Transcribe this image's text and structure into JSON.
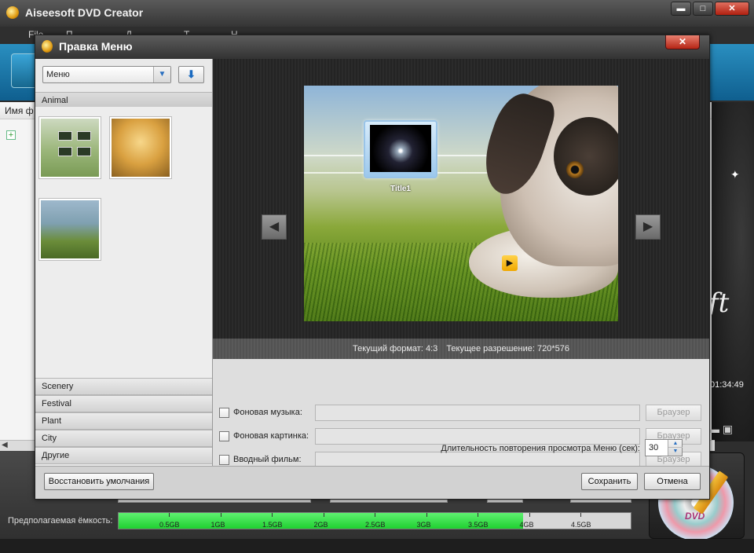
{
  "main_window": {
    "title": "Aiseesoft DVD Creator",
    "menu": [
      "File",
      "П",
      "Д",
      "T",
      "H"
    ],
    "window_buttons": {
      "minimize": "▬",
      "maximize": "□",
      "close": "✕"
    },
    "list_header": "Имя ф",
    "right_time": "01:34:49",
    "right_brand_fragment": "ft",
    "capacity_label": "Предполагаемая ёмкость:",
    "capacity_ticks": [
      "0.5GB",
      "1GB",
      "1.5GB",
      "2GB",
      "2.5GB",
      "3GB",
      "3.5GB",
      "4GB",
      "4.5GB"
    ],
    "capacity_fill_percent": 79,
    "disc_text": "DVD",
    "expand_glyph": "+"
  },
  "dialog": {
    "title": "Правка Меню",
    "close_glyph": "✕",
    "template_select": {
      "value": "Меню"
    },
    "categories_top": "Animal",
    "categories_bottom": [
      "Scenery",
      "Festival",
      "Plant",
      "City",
      "Другие"
    ],
    "preview": {
      "title_label": "Title1",
      "prev_glyph": "◀",
      "next_glyph": "▶",
      "play_glyph": "▶"
    },
    "info": {
      "format": "Текущий формат: 4:3",
      "resolution": "Текущее разрешение: 720*576"
    },
    "settings": {
      "music_label": "Фоновая музыка:",
      "picture_label": "Фоновая картинка:",
      "intro_label": "Вводный фильм:",
      "browse_label": "Браузер",
      "duration_label": "Длительность повторения просмотра Меню (сек):",
      "duration_value": "30"
    },
    "buttons": {
      "reset": "Восстановить умолчания",
      "save": "Сохранить",
      "cancel": "Отмена"
    }
  },
  "colors": {
    "capacity_fill": "#1fd030",
    "toolbar_blue": "#1a7fb0",
    "close_red": "#c03020"
  }
}
